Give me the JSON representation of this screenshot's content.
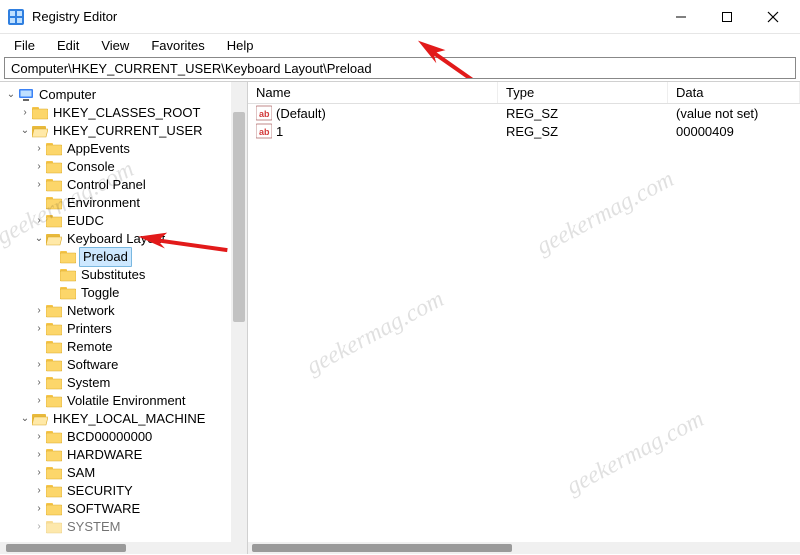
{
  "window": {
    "title": "Registry Editor"
  },
  "menubar": {
    "file": "File",
    "edit": "Edit",
    "view": "View",
    "favorites": "Favorites",
    "help": "Help"
  },
  "addressbar": {
    "path": "Computer\\HKEY_CURRENT_USER\\Keyboard Layout\\Preload"
  },
  "tree": {
    "root": "Computer",
    "hkcr": "HKEY_CLASSES_ROOT",
    "hkcu": "HKEY_CURRENT_USER",
    "appevents": "AppEvents",
    "console": "Console",
    "controlpanel": "Control Panel",
    "environment": "Environment",
    "eudc": "EUDC",
    "keyboardlayout": "Keyboard Layout",
    "preload": "Preload",
    "substitutes": "Substitutes",
    "toggle": "Toggle",
    "network": "Network",
    "printers": "Printers",
    "remote": "Remote",
    "software": "Software",
    "system": "System",
    "volatile": "Volatile Environment",
    "hklm": "HKEY_LOCAL_MACHINE",
    "bcd": "BCD00000000",
    "hardware": "HARDWARE",
    "sam": "SAM",
    "security": "SECURITY",
    "softwarehklm": "SOFTWARE",
    "systemhklm": "SYSTEM"
  },
  "columns": {
    "name": "Name",
    "type": "Type",
    "data": "Data"
  },
  "rows": [
    {
      "name": "(Default)",
      "type": "REG_SZ",
      "data": "(value not set)"
    },
    {
      "name": "1",
      "type": "REG_SZ",
      "data": "00000409"
    }
  ],
  "watermark": "geekermag.com"
}
